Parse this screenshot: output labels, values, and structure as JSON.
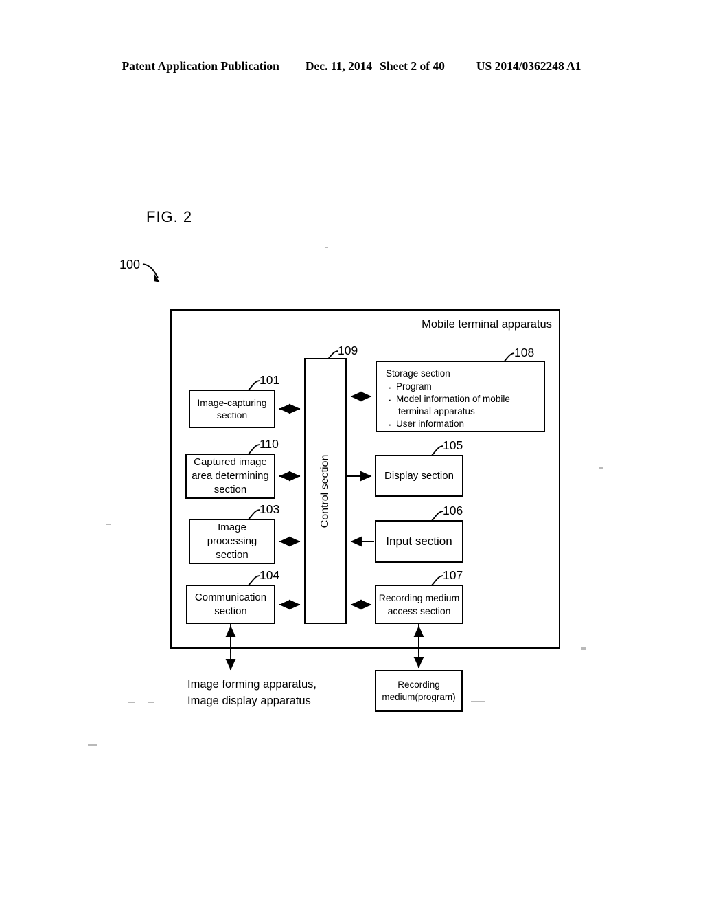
{
  "header": {
    "publication": "Patent Application Publication",
    "date": "Dec. 11, 2014",
    "sheet": "Sheet 2 of 40",
    "docnum": "US 2014/0362248 A1"
  },
  "figure": {
    "label": "FIG. 2",
    "system_ref": "100",
    "frame_title": "Mobile terminal apparatus"
  },
  "blocks": {
    "image_capturing": {
      "ref": "101",
      "line1": "Image-capturing",
      "line2": "section"
    },
    "captured_area": {
      "ref": "110",
      "line1": "Captured image",
      "line2": "area determining",
      "line3": "section"
    },
    "image_processing": {
      "ref": "103",
      "line1": "Image",
      "line2": "processing",
      "line3": "section"
    },
    "communication": {
      "ref": "104",
      "line1": "Communication",
      "line2": "section"
    },
    "control": {
      "ref": "109",
      "label": "Control section"
    },
    "storage": {
      "ref": "108",
      "title": "Storage section",
      "items": [
        {
          "text": "Program",
          "cont": ""
        },
        {
          "text": "Model information of mobile",
          "cont": "terminal apparatus"
        },
        {
          "text": "User information",
          "cont": ""
        }
      ]
    },
    "display": {
      "ref": "105",
      "label": "Display section"
    },
    "input": {
      "ref": "106",
      "label": "Input section"
    },
    "recording_access": {
      "ref": "107",
      "line1": "Recording medium",
      "line2": "access section"
    },
    "recording_medium": {
      "line1": "Recording",
      "line2": "medium(program)"
    }
  },
  "external": {
    "line1": "Image forming apparatus,",
    "line2": "Image display apparatus"
  }
}
